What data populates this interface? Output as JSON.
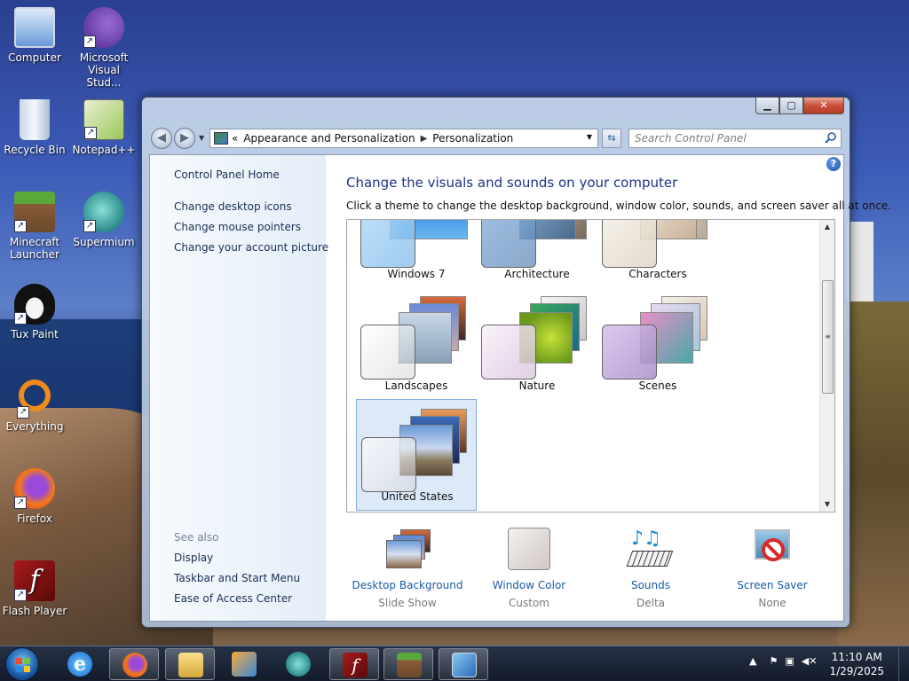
{
  "desktop": {
    "icons": [
      {
        "label": "Computer"
      },
      {
        "label": "Microsoft Visual Stud..."
      },
      {
        "label": "Recycle Bin"
      },
      {
        "label": "Notepad++"
      },
      {
        "label": "Minecraft Launcher"
      },
      {
        "label": "Supermium"
      },
      {
        "label": "Tux Paint"
      },
      {
        "label": "Everything"
      },
      {
        "label": "Firefox"
      },
      {
        "label": "Flash Player"
      }
    ]
  },
  "window": {
    "breadcrumb": {
      "overflow": "«",
      "items": [
        "Appearance and Personalization",
        "Personalization"
      ]
    },
    "search_placeholder": "Search Control Panel",
    "left_pane": {
      "home": "Control Panel Home",
      "links": [
        "Change desktop icons",
        "Change mouse pointers",
        "Change your account picture"
      ],
      "see_also_label": "See also",
      "see_also": [
        "Display",
        "Taskbar and Start Menu",
        "Ease of Access Center"
      ]
    },
    "title": "Change the visuals and sounds on your computer",
    "description": "Click a theme to change the desktop background, window color, sounds, and screen saver all at once.",
    "themes": [
      {
        "name": "Windows 7",
        "selected": false
      },
      {
        "name": "Architecture",
        "selected": false
      },
      {
        "name": "Characters",
        "selected": false
      },
      {
        "name": "Landscapes",
        "selected": false
      },
      {
        "name": "Nature",
        "selected": false
      },
      {
        "name": "Scenes",
        "selected": false
      },
      {
        "name": "United States",
        "selected": true
      }
    ],
    "bottom": [
      {
        "title": "Desktop Background",
        "value": "Slide Show",
        "icon": "desktop-background-icon"
      },
      {
        "title": "Window Color",
        "value": "Custom",
        "icon": "window-color-icon"
      },
      {
        "title": "Sounds",
        "value": "Delta",
        "icon": "sounds-icon"
      },
      {
        "title": "Screen Saver",
        "value": "None",
        "icon": "screen-saver-icon"
      }
    ]
  },
  "taskbar": {
    "time": "11:10 AM",
    "date": "1/29/2025"
  }
}
